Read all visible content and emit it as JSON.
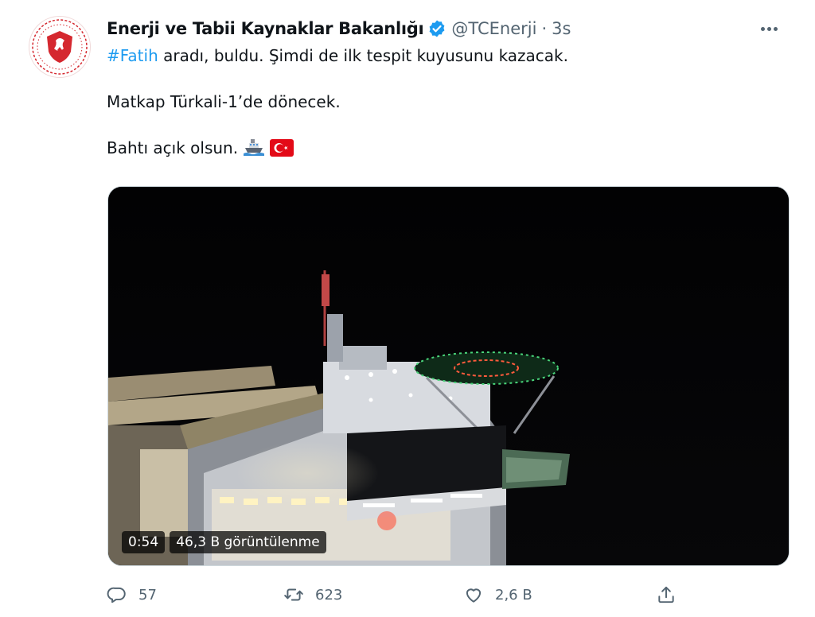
{
  "author": {
    "name": "Enerji ve Tabii Kaynaklar Bakanlığı",
    "handle": "@TCEnerji",
    "separator": "·",
    "time": "3s",
    "verified": true,
    "avatar_icon": "ministry-emblem-icon"
  },
  "tweet": {
    "hashtag": "#Fatih",
    "line1_rest": " aradı, buldu. Şimdi de ilk tespit kuyusunu kazacak.",
    "line2": "Matkap Türkali-1’de dönecek.",
    "line3": "Bahtı açık olsun.",
    "emojis": [
      "ship-emoji-icon",
      "turkey-flag-emoji-icon"
    ]
  },
  "media": {
    "type": "video",
    "duration": "0:54",
    "views": "46,3 B görüntülenme",
    "description_icon": "drillship-at-night-video"
  },
  "actions": {
    "reply": {
      "icon": "reply-icon",
      "count": "57"
    },
    "retweet": {
      "icon": "retweet-icon",
      "count": "623"
    },
    "like": {
      "icon": "heart-icon",
      "count": "2,6 B"
    },
    "share": {
      "icon": "share-icon"
    }
  },
  "colors": {
    "link": "#1d9bf0",
    "text": "#0f1419",
    "secondary": "#536471",
    "verified": "#1d9bf0",
    "emblem": "#d5282f"
  }
}
